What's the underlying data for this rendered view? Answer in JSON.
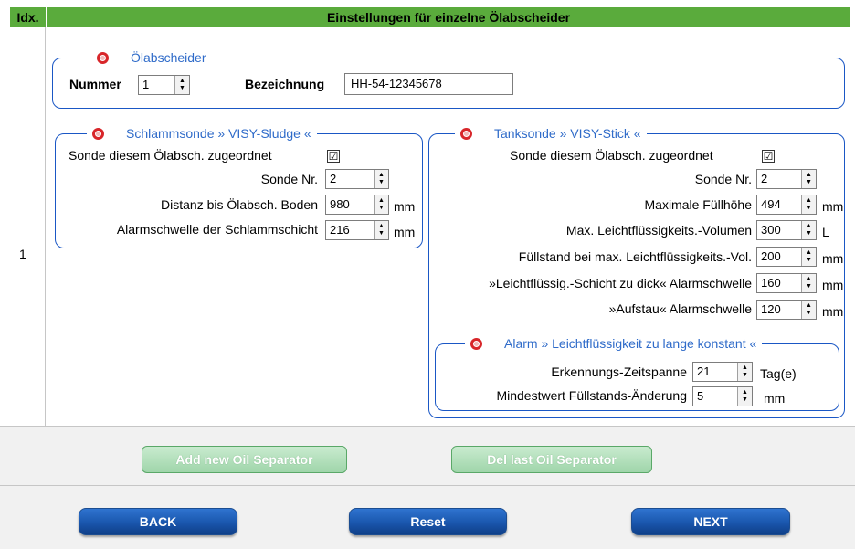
{
  "header": {
    "idx_label": "Idx.",
    "title": "Einstellungen für einzelne Ölabscheider"
  },
  "row": {
    "index": "1"
  },
  "separator": {
    "legend": "Ölabscheider",
    "nummer_label": "Nummer",
    "nummer_value": "1",
    "bezeichnung_label": "Bezeichnung",
    "bezeichnung_value": "HH-54-12345678"
  },
  "sludge": {
    "legend": "Schlammsonde  » VISY-Sludge  «",
    "assigned_label": "Sonde diesem Ölabsch. zugeordnet",
    "assigned_checked": "☑",
    "probe_nr_label": "Sonde Nr.",
    "probe_nr_value": "2",
    "distance_label": "Distanz bis Ölabsch. Boden",
    "distance_value": "980",
    "distance_unit": "mm",
    "threshold_label": "Alarmschwelle der Schlammschicht",
    "threshold_value": "216",
    "threshold_unit": "mm"
  },
  "tank": {
    "legend": "Tanksonde  » VISY-Stick  «",
    "assigned_label": "Sonde diesem Ölabsch. zugeordnet",
    "probe_nr_label": "Sonde Nr.",
    "probe_nr_value": "2",
    "max_fill_label": "Maximale Füllhöhe",
    "max_fill_value": "494",
    "max_fill_unit": "mm",
    "max_volume_label": "Max. Leichtflüssigkeits.-Volumen",
    "max_volume_value": "300",
    "max_volume_unit": "L",
    "level_at_max_label": "Füllstand bei max. Leichtflüssigkeits.-Vol.",
    "level_at_max_value": "200",
    "level_at_max_unit": "mm",
    "thick_label": "»Leichtflüssig.-Schicht zu dick« Alarmschwelle",
    "thick_value": "160",
    "thick_unit": "mm",
    "backlog_label": "»Aufstau« Alarmschwelle",
    "backlog_value": "120",
    "backlog_unit": "mm"
  },
  "alarm": {
    "legend": "Alarm » Leichtflüssigkeit zu lange konstant «",
    "period_label": "Erkennungs-Zeitspanne",
    "period_value": "21",
    "period_unit": "Tag(e)",
    "min_change_label": "Mindestwert Füllstands-Änderung",
    "min_change_value": "5",
    "min_change_unit": "mm"
  },
  "actions": {
    "add": "Add new Oil Separator",
    "del": "Del last Oil Separator"
  },
  "nav": {
    "back": "BACK",
    "reset": "Reset",
    "next": "NEXT"
  },
  "colors": {
    "header_green": "#5aab3c",
    "fieldset_blue": "#1a57c5",
    "legend_blue": "#2f6bc9",
    "nav_blue": "#1a56ad"
  }
}
